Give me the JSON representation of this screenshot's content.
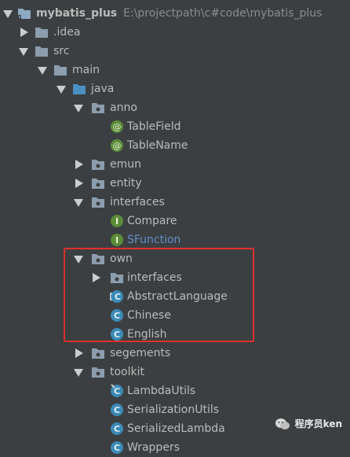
{
  "tree": {
    "root": {
      "name": "mybatis_plus",
      "path": "E:\\projectpath\\c#code\\mybatis_plus"
    },
    "items": [
      {
        "label": ".idea"
      },
      {
        "label": "src"
      },
      {
        "label": "main"
      },
      {
        "label": "java"
      },
      {
        "label": "anno"
      },
      {
        "label": "TableField"
      },
      {
        "label": "TableName"
      },
      {
        "label": "emun"
      },
      {
        "label": "entity"
      },
      {
        "label": "interfaces"
      },
      {
        "label": "Compare"
      },
      {
        "label": "SFunction"
      },
      {
        "label": "own"
      },
      {
        "label": "interfaces"
      },
      {
        "label": "AbstractLanguage"
      },
      {
        "label": "Chinese"
      },
      {
        "label": "English"
      },
      {
        "label": "segements"
      },
      {
        "label": "toolkit"
      },
      {
        "label": "LambdaUtils"
      },
      {
        "label": "SerializationUtils"
      },
      {
        "label": "SerializedLambda"
      },
      {
        "label": "Wrappers"
      }
    ]
  },
  "icon_letters": {
    "annotation": "@",
    "interface": "I",
    "class": "C"
  },
  "watermark": {
    "text": "程序员ken"
  },
  "colors": {
    "background": "#3c3f41",
    "text": "#bbbbbb",
    "highlight": "#e0302e",
    "annotation_icon": "#5b8c3a",
    "interface_icon": "#5b8c3a",
    "class_icon": "#3b8bb6",
    "link_text": "#5f8ec9"
  }
}
